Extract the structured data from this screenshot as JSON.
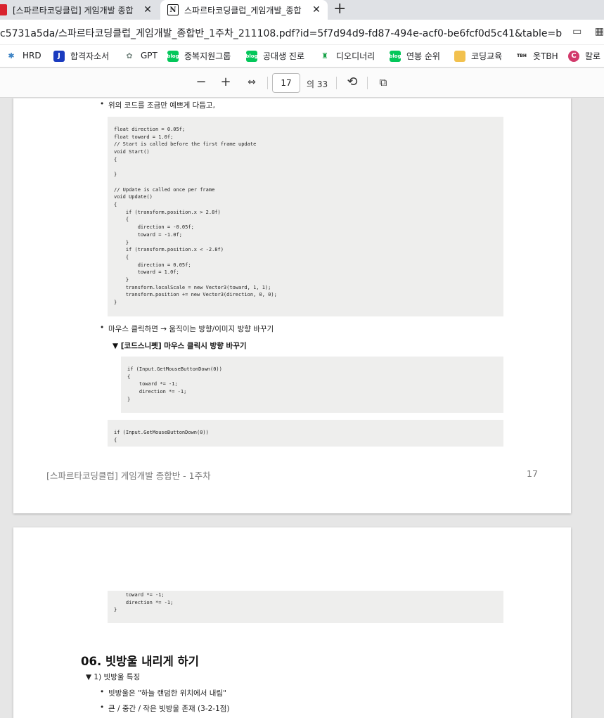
{
  "tabs": [
    {
      "title": "[스파르타코딩클럽] 게임개발 종합",
      "close": "✕"
    },
    {
      "title": "스파르타코딩클럽_게임개발_종합",
      "close": "✕"
    }
  ],
  "new_tab": "+",
  "address_bar": {
    "url": "c5731a5da/스파르타코딩클럽_게임개발_종합반_1주차_211108.pdf?id=5f7d94d9-fd87-494e-acf0-be6fcf0d5c41&table=block&..."
  },
  "bookmarks": [
    {
      "label": "HRD",
      "icon": "hrd-icon",
      "color": "#3b82c4",
      "glyph": "✱"
    },
    {
      "label": "합격자소서",
      "icon": "j-icon",
      "color": "#1a3bbf",
      "glyph": "J"
    },
    {
      "label": "GPT",
      "icon": "openai-icon",
      "color": "#7a8a84",
      "glyph": "✿"
    },
    {
      "label": "중복지원그룹",
      "icon": "blog-icon",
      "color": "#03c75a",
      "glyph": "blog"
    },
    {
      "label": "공대생 진로",
      "icon": "blog-icon",
      "color": "#03c75a",
      "glyph": "blog"
    },
    {
      "label": "디오디너리",
      "icon": "shield-icon",
      "color": "#1aa34a",
      "glyph": "♜"
    },
    {
      "label": "연봉 순위",
      "icon": "blog-icon",
      "color": "#03c75a",
      "glyph": "blog"
    },
    {
      "label": "코딩교육",
      "icon": "folder-icon",
      "color": "#f2c14e",
      "glyph": ""
    },
    {
      "label": "옷TBH",
      "icon": "tbh-icon",
      "color": "#ffffff",
      "glyph": "TBH"
    },
    {
      "label": "칼로",
      "icon": "c-icon",
      "color": "#d23a6b",
      "glyph": "C"
    }
  ],
  "pdf_toolbar": {
    "zoom_out": "−",
    "zoom_in": "+",
    "fit": "⇔",
    "page": "17",
    "page_count": "의 33",
    "rotate": "⟲",
    "two_page": "⧉"
  },
  "page17": {
    "bullet1": "위의 코드를 조금만 예쁘게 다듬고,",
    "code1": "float direction = 0.05f;\nfloat toward = 1.0f;\n// Start is called before the first frame update\nvoid Start()\n{\n\n}\n\n// Update is called once per frame\nvoid Update()\n{\n    if (transform.position.x > 2.8f)\n    {\n        direction = -0.05f;\n        toward = -1.0f;\n    }\n    if (transform.position.x < -2.8f)\n    {\n        direction = 0.05f;\n        toward = 1.0f;\n    }\n    transform.localScale = new Vector3(toward, 1, 1);\n    transform.position += new Vector3(direction, 0, 0);\n}",
    "bullet2": "마우스 클릭하면 → 움직이는 방향/이미지 방향 바꾸기",
    "toggle_title": "▼ [코드스니펫] 마우스 클릭시 방향 바꾸기",
    "code2": "if (Input.GetMouseButtonDown(0))\n{\n    toward *= -1;\n    direction *= -1;\n}",
    "code3": "if (Input.GetMouseButtonDown(0))\n{",
    "footer_title": "[스파르타코딩클럽] 게임개발 종합반 - 1주차",
    "footer_page": "17"
  },
  "page18": {
    "code_cont": "    toward *= -1;\n    direction *= -1;\n}",
    "heading": "06. 빗방울 내리게 하기",
    "subtoggle": "▼ 1) 빗방울 특징",
    "bullet_a": "빗방울은 \"하늘 랜덤한 위치에서 내림\"",
    "bullet_b": "큰 / 중간 / 작은 빗방울 존재 (3-2-1점)"
  }
}
